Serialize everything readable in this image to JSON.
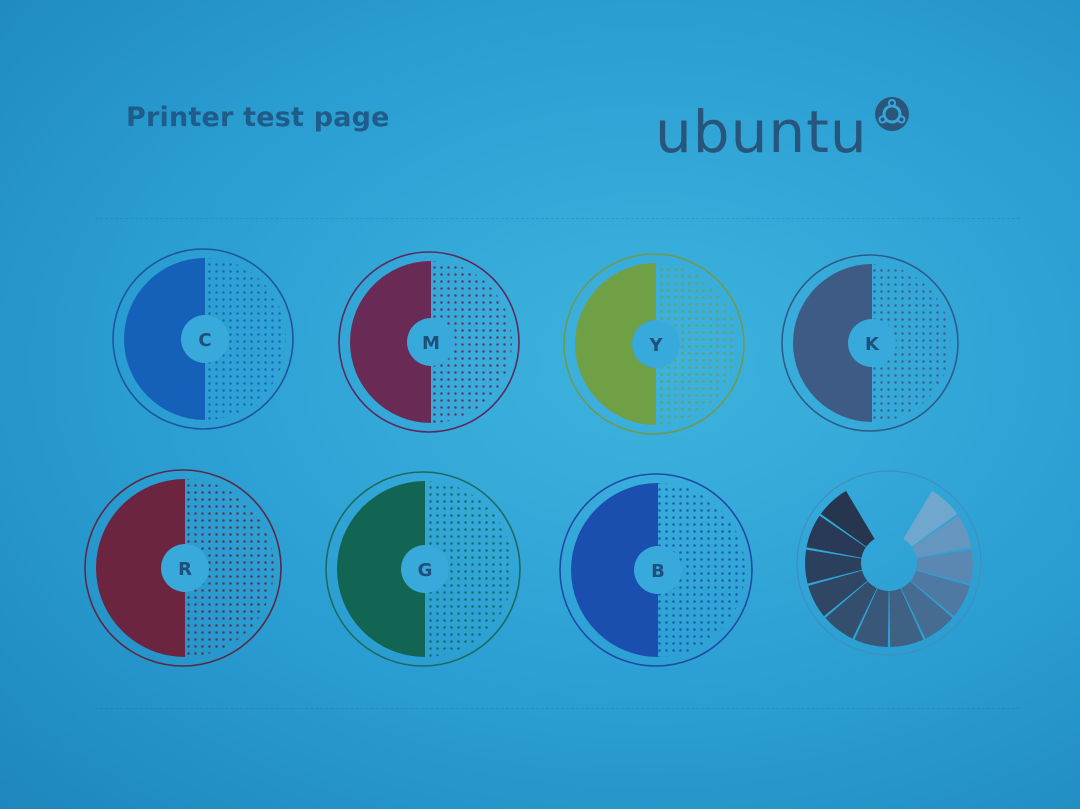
{
  "page": {
    "title": "Printer test page"
  },
  "logo": {
    "text": "ubuntu",
    "icon": "circle-of-friends-icon"
  },
  "swatches": [
    {
      "label": "C",
      "color": "#1560b9",
      "ring": "#1e55a0"
    },
    {
      "label": "M",
      "color": "#6a2a56",
      "ring": "#5a2a60"
    },
    {
      "label": "Y",
      "color": "#6fa046",
      "ring": "#6e9a50"
    },
    {
      "label": "K",
      "color": "#3d5b84",
      "ring": "#2e5c88"
    },
    {
      "label": "R",
      "color": "#6b2540",
      "ring": "#5a2a45"
    },
    {
      "label": "G",
      "color": "#136553",
      "ring": "#1d6a60"
    },
    {
      "label": "B",
      "color": "#1a4fb0",
      "ring": "#1e4aa8"
    }
  ],
  "gray_wheel": {
    "icon": "grayscale-wheel",
    "shades": [
      "#6fa7cf",
      "#6496c0",
      "#5a88b2",
      "#4f79a2",
      "#466c92",
      "#3f6184",
      "#395778",
      "#344f6e",
      "#2f4765",
      "#2b405d",
      "#283a57",
      "#26364f"
    ]
  }
}
